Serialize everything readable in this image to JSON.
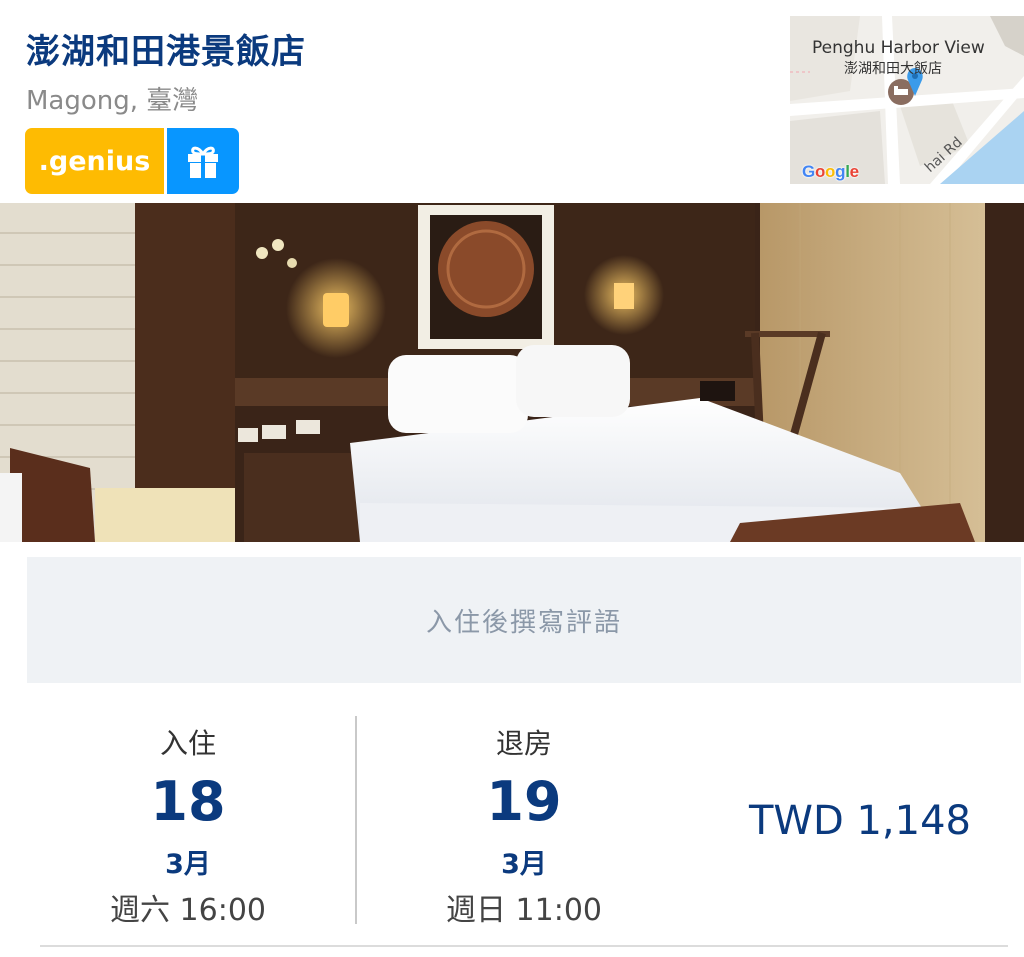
{
  "hotel": {
    "name": "澎湖和田港景飯店",
    "location": "Magong, 臺灣"
  },
  "badges": {
    "genius_label": ".genius",
    "gift_icon": "gift-icon"
  },
  "map": {
    "label_en": "Penghu Harbor View",
    "label_zh": "澎湖和田大飯店",
    "road": "hai Rd",
    "provider": "Google",
    "pin_icon": "map-pin-icon",
    "hotel_icon": "bed-icon"
  },
  "review": {
    "text": "入住後撰寫評語"
  },
  "checkin": {
    "label": "入住",
    "day": "18",
    "month": "3月",
    "time": "週六 16:00"
  },
  "checkout": {
    "label": "退房",
    "day": "19",
    "month": "3月",
    "time": "週日 11:00"
  },
  "price": {
    "text": "TWD 1,148"
  },
  "colors": {
    "brand_blue": "#0b3a7e",
    "genius_yellow": "#febb02",
    "gift_blue": "#0896ff",
    "review_bg": "#eff2f5"
  }
}
